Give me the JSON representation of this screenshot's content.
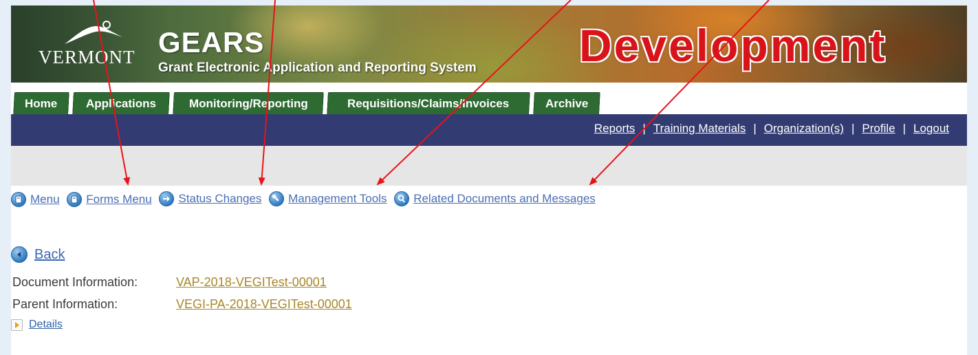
{
  "header": {
    "state_name": "VERMONT",
    "app_name": "GEARS",
    "app_subtitle": "Grant Electronic Application and Reporting System",
    "environment": "Development"
  },
  "tabs": [
    {
      "label": "Home"
    },
    {
      "label": "Applications"
    },
    {
      "label": "Monitoring/Reporting"
    },
    {
      "label": "Requisitions/Claims/Invoices"
    },
    {
      "label": "Archive"
    }
  ],
  "utility_links": [
    {
      "label": "Reports"
    },
    {
      "label": "Training Materials"
    },
    {
      "label": "Organization(s)"
    },
    {
      "label": "Profile"
    },
    {
      "label": "Logout"
    }
  ],
  "utility_separator": "|",
  "action_menu": [
    {
      "label": "Menu",
      "icon": "document-icon"
    },
    {
      "label": "Forms Menu",
      "icon": "document-icon"
    },
    {
      "label": "Status Changes",
      "icon": "arrow-right-icon"
    },
    {
      "label": "Management Tools",
      "icon": "wrench-icon"
    },
    {
      "label": "Related Documents and Messages",
      "icon": "magnifier-icon"
    }
  ],
  "back_label": "Back",
  "document_info": {
    "doc_label": "Document Information:",
    "doc_value": "VAP-2018-VEGITest-00001",
    "parent_label": "Parent Information:",
    "parent_value": "VEGI-PA-2018-VEGITest-00001"
  },
  "details_label": "Details",
  "colors": {
    "tab_green": "#2e6b32",
    "nav_blue": "#323c72",
    "env_red": "#d8141a",
    "link_blue": "#4a6eb3",
    "doc_link_gold": "#a8872a",
    "annotation_red": "#e8121a"
  }
}
